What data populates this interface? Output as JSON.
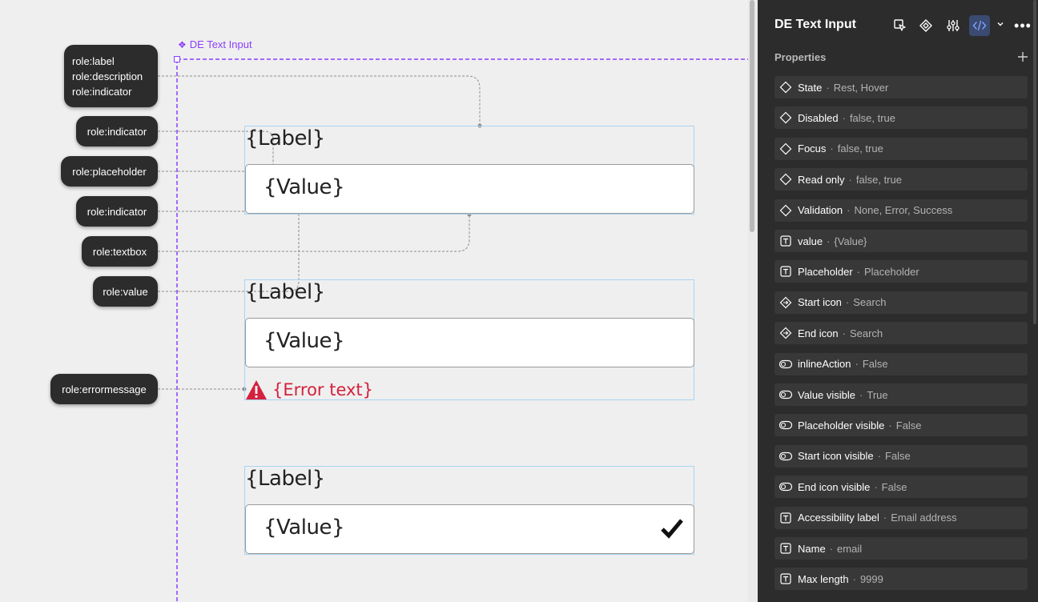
{
  "canvas": {
    "frame_title": "DE Text Input",
    "roles": {
      "group": [
        "role:label",
        "role:description",
        "role:indicator"
      ],
      "indicator_1": "role:indicator",
      "placeholder": "role:placeholder",
      "indicator_2": "role:indicator",
      "textbox": "role:textbox",
      "value": "role:value",
      "errormessage": "role:errormessage"
    },
    "variants": [
      {
        "label": "{Label}",
        "value": "{Value}"
      },
      {
        "label": "{Label}",
        "value": "{Value}",
        "error": "{Error text}"
      },
      {
        "label": "{Label}",
        "value": "{Value}"
      }
    ]
  },
  "panel": {
    "title": "DE Text Input",
    "section_title": "Properties",
    "properties": [
      {
        "icon": "variant",
        "name": "State",
        "value": "Rest, Hover"
      },
      {
        "icon": "variant",
        "name": "Disabled",
        "value": "false, true"
      },
      {
        "icon": "variant",
        "name": "Focus",
        "value": "false, true"
      },
      {
        "icon": "variant",
        "name": "Read only",
        "value": "false, true"
      },
      {
        "icon": "variant",
        "name": "Validation",
        "value": "None, Error, Success"
      },
      {
        "icon": "text",
        "name": "value",
        "value": "{Value}"
      },
      {
        "icon": "text",
        "name": "Placeholder",
        "value": "Placeholder"
      },
      {
        "icon": "instance",
        "name": "Start icon",
        "value": "Search"
      },
      {
        "icon": "instance",
        "name": "End icon",
        "value": "Search"
      },
      {
        "icon": "boolean",
        "name": "inlineAction",
        "value": "False"
      },
      {
        "icon": "boolean",
        "name": "Value visible",
        "value": "True"
      },
      {
        "icon": "boolean",
        "name": "Placeholder visible",
        "value": "False"
      },
      {
        "icon": "boolean",
        "name": "Start icon visible",
        "value": "False"
      },
      {
        "icon": "boolean",
        "name": "End icon visible",
        "value": "False"
      },
      {
        "icon": "text",
        "name": "Accessibility label",
        "value": "Email address"
      },
      {
        "icon": "text",
        "name": "Name",
        "value": "email"
      },
      {
        "icon": "text",
        "name": "Max length",
        "value": "9999"
      }
    ]
  },
  "colors": {
    "selection": "#8a3ffc",
    "error": "#d4213d",
    "panel_bg": "#2c2c2c",
    "row_bg": "#383838"
  }
}
